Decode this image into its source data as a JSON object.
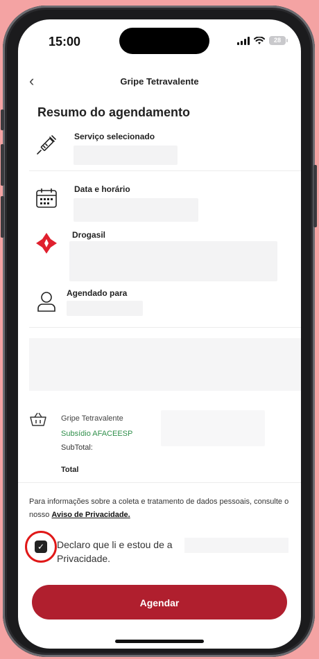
{
  "status_bar": {
    "time": "15:00",
    "battery": "28"
  },
  "header": {
    "back_glyph": "‹",
    "title": "Gripe Tetravalente"
  },
  "summary_title": "Resumo do agendamento",
  "rows": [
    {
      "icon": "syringe-icon",
      "label": "Serviço selecionado"
    },
    {
      "icon": "calendar-icon",
      "label": "Data e horário"
    },
    {
      "icon": "drogasil-logo",
      "label": "Drogasil"
    },
    {
      "icon": "user-icon",
      "label": "Agendado para"
    }
  ],
  "order": {
    "item": "Gripe Tetravalente",
    "subsidy": "Subsídio AFACEESP",
    "subtotal_label": "SubTotal:",
    "total_label": "Total"
  },
  "privacy": {
    "text": "Para informações sobre a coleta e tratamento de dados pessoais, consulte o nosso ",
    "link": "Aviso de Privacidade."
  },
  "consent": {
    "text": "Declaro que li e estou de a",
    "text2": "Privacidade.",
    "checked": true
  },
  "cta": {
    "label": "Agendar"
  },
  "colors": {
    "brand": "#b01f2e",
    "green": "#2f8f4a",
    "highlight": "#e01818"
  }
}
